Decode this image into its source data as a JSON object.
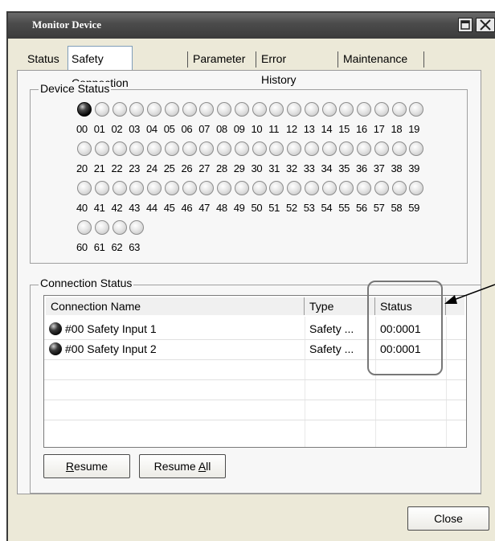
{
  "window": {
    "title": "Monitor Device"
  },
  "tabs": [
    {
      "label": "Status"
    },
    {
      "label": "Safety Connection"
    },
    {
      "label": "Parameter"
    },
    {
      "label": "Error History"
    },
    {
      "label": "Maintenance"
    }
  ],
  "active_tab": "Safety Connection",
  "device_status": {
    "title": "Device Status",
    "rows": [
      [
        "00",
        "01",
        "02",
        "03",
        "04",
        "05",
        "06",
        "07",
        "08",
        "09",
        "10",
        "11",
        "12",
        "13",
        "14",
        "15",
        "16",
        "17",
        "18",
        "19"
      ],
      [
        "20",
        "21",
        "22",
        "23",
        "24",
        "25",
        "26",
        "27",
        "28",
        "29",
        "30",
        "31",
        "32",
        "33",
        "34",
        "35",
        "36",
        "37",
        "38",
        "39"
      ],
      [
        "40",
        "41",
        "42",
        "43",
        "44",
        "45",
        "46",
        "47",
        "48",
        "49",
        "50",
        "51",
        "52",
        "53",
        "54",
        "55",
        "56",
        "57",
        "58",
        "59"
      ],
      [
        "60",
        "61",
        "62",
        "63"
      ]
    ],
    "active_nodes": [
      "00"
    ]
  },
  "connection_status": {
    "title": "Connection Status",
    "columns": [
      "Connection Name",
      "Type",
      "Status"
    ],
    "rows": [
      {
        "name": "#00 Safety Input 1",
        "type": "Safety ...",
        "status": "00:0001",
        "indicator": "on"
      },
      {
        "name": "#00 Safety Input 2",
        "type": "Safety ...",
        "status": "00:0001",
        "indicator": "on"
      }
    ]
  },
  "buttons": {
    "resume_prefix": "R",
    "resume_rest": "esume",
    "resume_all_prefix": "Resume ",
    "resume_all_u": "A",
    "resume_all_rest": "ll",
    "close": "Close"
  },
  "icons": {
    "maximize": "maximize-icon",
    "close": "close-icon",
    "led": "status-led-icon"
  }
}
